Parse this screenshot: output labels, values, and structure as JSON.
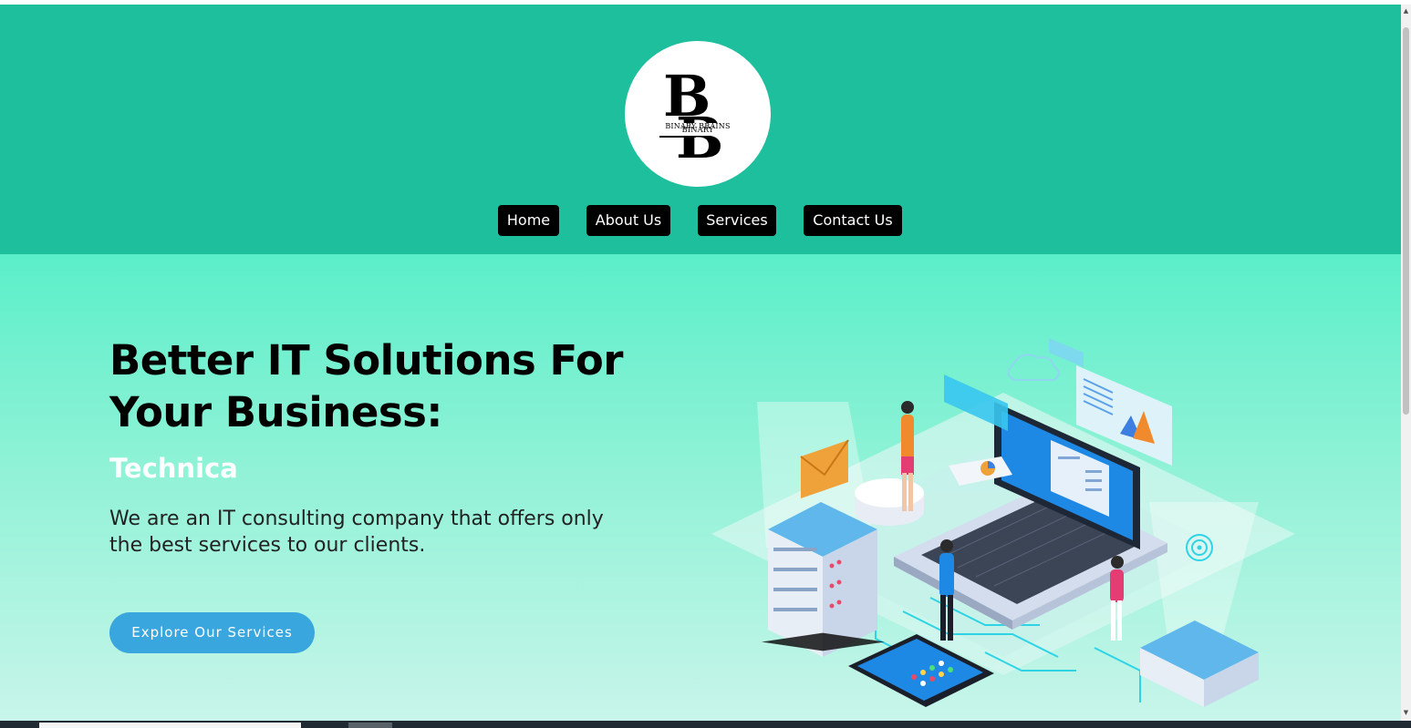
{
  "brand": {
    "logo_monogram": "BB",
    "logo_text": "BINARY BRAINS"
  },
  "nav": {
    "items": [
      {
        "label": "Home"
      },
      {
        "label": "About Us"
      },
      {
        "label": "Services"
      },
      {
        "label": "Contact Us"
      }
    ]
  },
  "hero": {
    "title_line1": "Better IT Solutions For",
    "title_line2": "Your Business:",
    "subtitle": "Technica",
    "description_line1": "We are an IT consulting company that offers only",
    "description_line2": "the best services to our clients.",
    "cta_label": "Explore Our Services"
  },
  "colors": {
    "header_bg": "#1dbf9d",
    "hero_gradient_top": "#5aefc9",
    "hero_gradient_bottom": "#c8f5ea",
    "nav_button_bg": "#000000",
    "cta_bg": "#3aa6de"
  },
  "illustration": {
    "icon": "it-isometric-illustration"
  }
}
